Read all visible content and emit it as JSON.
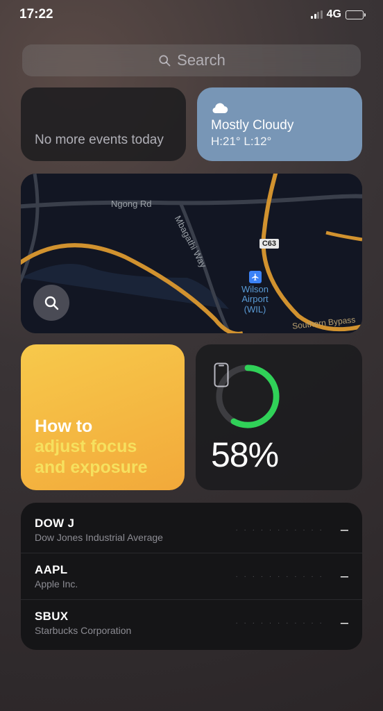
{
  "status": {
    "time": "17:22",
    "network": "4G"
  },
  "search": {
    "placeholder": "Search"
  },
  "calendar": {
    "text": "No more events today"
  },
  "weather": {
    "condition": "Mostly Cloudy",
    "hi_lo": "H:21° L:12°"
  },
  "map": {
    "road_1": "Ngong Rd",
    "road_2": "Mbagathi Way",
    "route_badge": "C63",
    "airport": "Wilson\nAirport\n(WIL)",
    "bypass": "Southern Bypass"
  },
  "tips": {
    "line1": "How to",
    "line2": "adjust focus",
    "line3": "and exposure"
  },
  "battery_widget": {
    "percent": 58,
    "label": "58%"
  },
  "stocks": [
    {
      "symbol": "DOW J",
      "company": "Dow Jones Industrial Average",
      "value": "–"
    },
    {
      "symbol": "AAPL",
      "company": "Apple Inc.",
      "value": "–"
    },
    {
      "symbol": "SBUX",
      "company": "Starbucks Corporation",
      "value": "–"
    }
  ],
  "colors": {
    "battery_ring": "#30d158"
  }
}
